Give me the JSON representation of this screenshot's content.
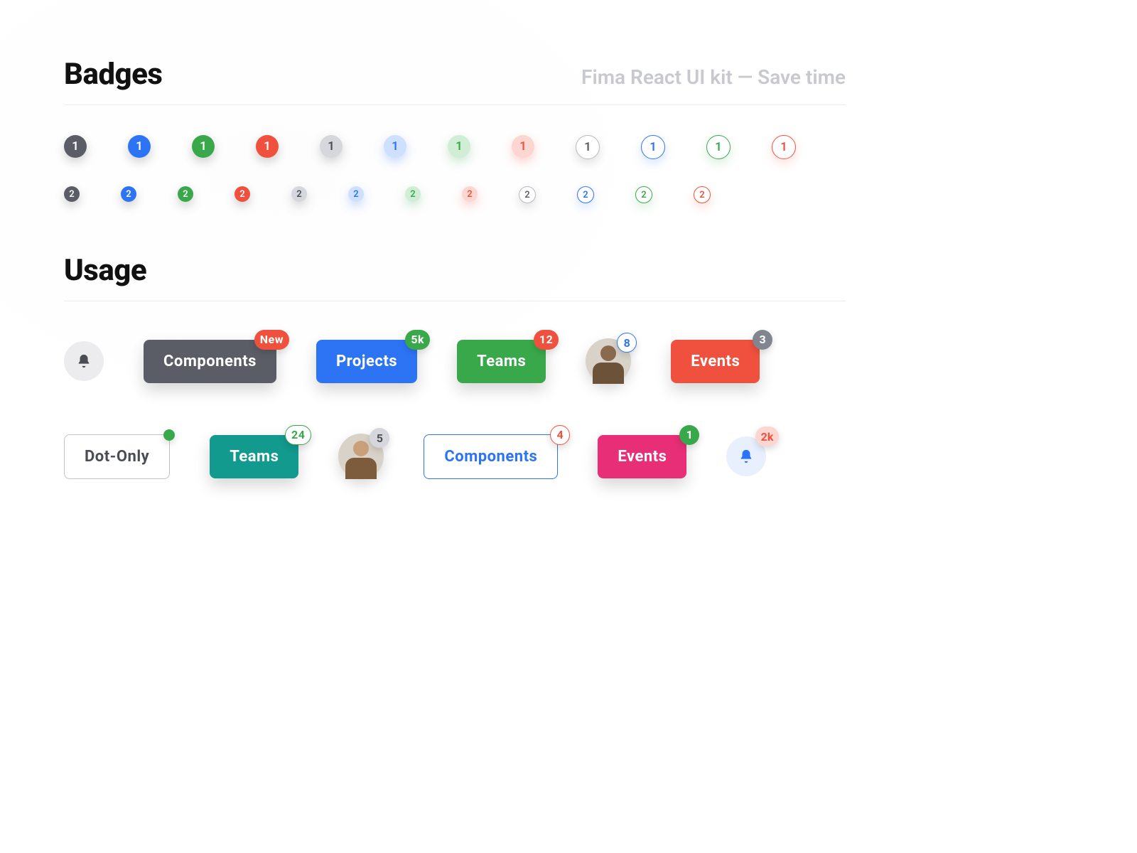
{
  "header": {
    "title": "Badges",
    "tagline": "Fima React UI kit — Save time"
  },
  "badges": {
    "row1_value": "1",
    "row2_value": "2"
  },
  "usage": {
    "title": "Usage",
    "row1": {
      "components": {
        "label": "Components",
        "badge": "New"
      },
      "projects": {
        "label": "Projects",
        "badge": "5k"
      },
      "teams": {
        "label": "Teams",
        "badge": "12"
      },
      "avatar": {
        "badge": "8"
      },
      "events": {
        "label": "Events",
        "badge": "3"
      }
    },
    "row2": {
      "dotonly": {
        "label": "Dot-Only"
      },
      "teams": {
        "label": "Teams",
        "badge": "24"
      },
      "avatar": {
        "badge": "5"
      },
      "components": {
        "label": "Components",
        "badge": "4"
      },
      "events": {
        "label": "Events",
        "badge": "1"
      },
      "bell": {
        "badge": "2k"
      }
    }
  }
}
